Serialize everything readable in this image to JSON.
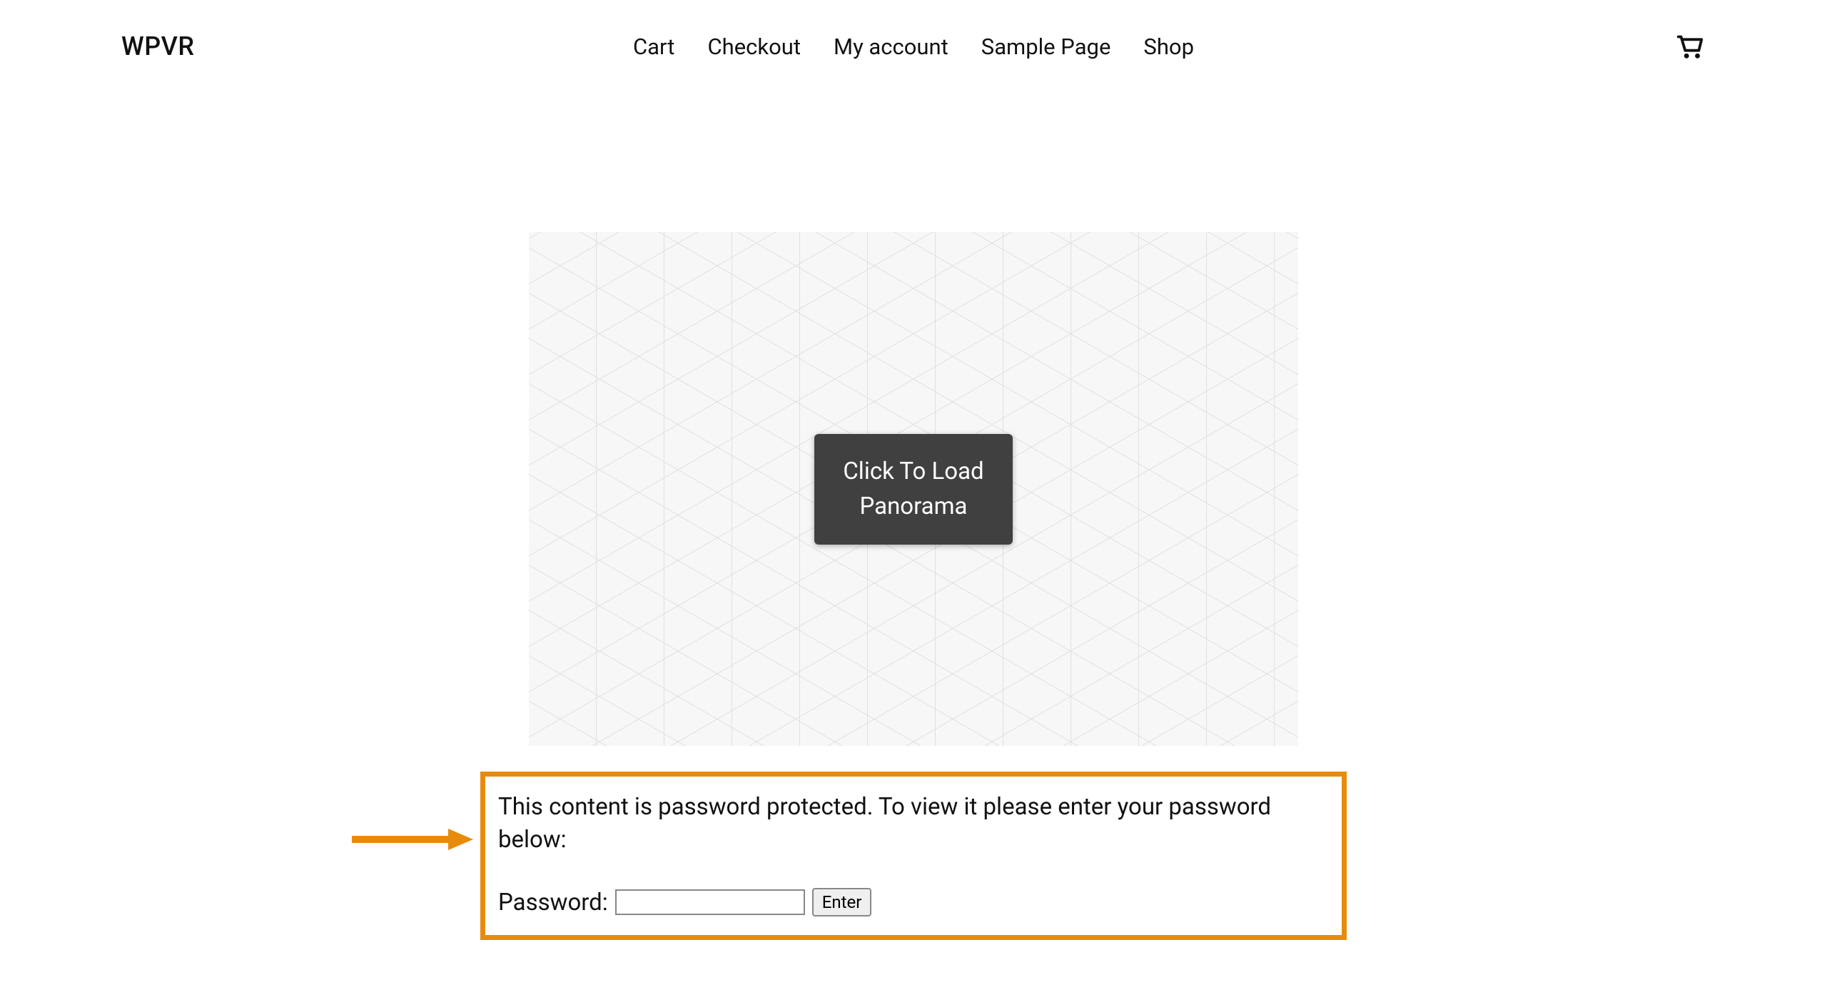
{
  "header": {
    "logo": "WPVR",
    "nav": {
      "items": [
        {
          "label": "Cart"
        },
        {
          "label": "Checkout"
        },
        {
          "label": "My account"
        },
        {
          "label": "Sample Page"
        },
        {
          "label": "Shop"
        }
      ]
    },
    "cart_icon": "cart-icon"
  },
  "panorama": {
    "button_line1": "Click To Load",
    "button_line2": "Panorama"
  },
  "password_protect": {
    "message": "This content is password protected. To view it please enter your password below:",
    "label": "Password:",
    "enter_label": "Enter"
  },
  "colors": {
    "highlight": "#e88b0c",
    "panorama_btn_bg": "#404040"
  }
}
